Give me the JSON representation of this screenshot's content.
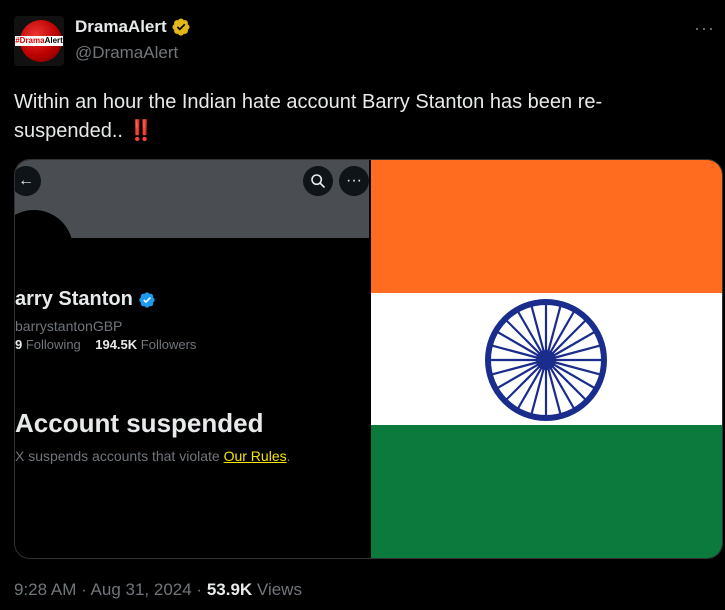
{
  "author": {
    "display_name": "DramaAlert",
    "handle": "@DramaAlert",
    "avatar_logo_left": "#Drama",
    "avatar_logo_right": "Alert",
    "verified_icon": "gold-verified-badge"
  },
  "tweet": {
    "text": "Within an hour the Indian hate account Barry Stanton has been re-suspended.. ",
    "emoji": "‼️"
  },
  "media_left": {
    "profile_name": "arry Stanton",
    "profile_handle": "barrystantonGBP",
    "following_count": "9",
    "following_label": "Following",
    "followers_count": "194.5K",
    "followers_label": "Followers",
    "suspended_title": "Account suspended",
    "suspended_text": "X suspends accounts that violate ",
    "rules_link": "Our Rules",
    "suspended_end": "."
  },
  "media_right": {
    "flag": "India",
    "colors": {
      "saffron": "#ff6b1f",
      "white": "#ffffff",
      "green": "#0c7a3c",
      "chakra": "#1a2c8c"
    }
  },
  "meta": {
    "time": "9:28 AM",
    "sep1": " · ",
    "date": "Aug 31, 2024",
    "sep2": " · ",
    "views_count": "53.9K",
    "views_label": " Views"
  },
  "icons": {
    "more": "more-icon",
    "back": "arrow-left-icon",
    "search": "search-icon"
  }
}
